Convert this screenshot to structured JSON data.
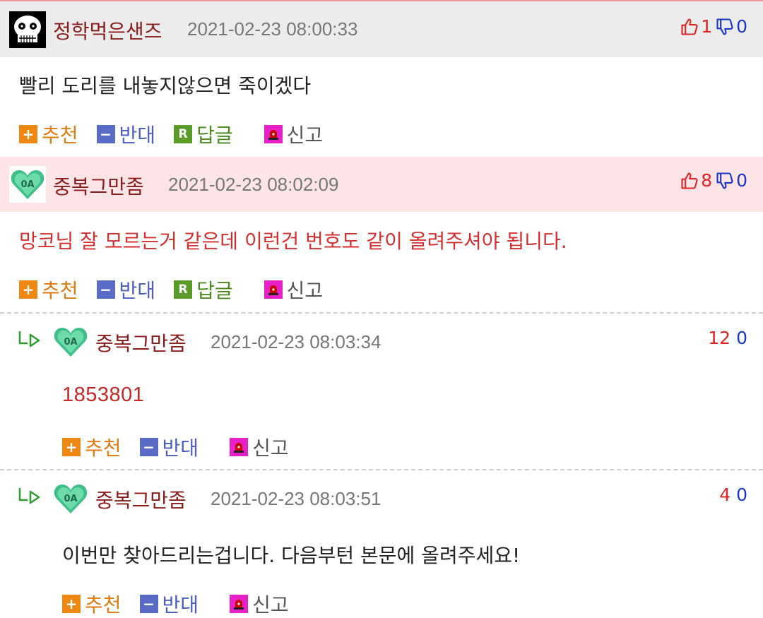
{
  "comments": [
    {
      "nick": "정학먹은샌즈",
      "date": "2021-02-23 08:00:33",
      "up": "1",
      "down": "0",
      "text": "빨리 도리를 내놓지않으면 죽이겠다",
      "avatar_icon": "skull-avatar-icon"
    },
    {
      "nick": "중복그만좀",
      "date": "2021-02-23 08:02:09",
      "up": "8",
      "down": "0",
      "text": "망코님 잘 모르는거 같은데 이런건 번호도 같이 올려주셔야 됩니다.",
      "avatar_icon": "heart-avatar-icon"
    },
    {
      "nick": "중복그만좀",
      "date": "2021-02-23 08:03:34",
      "up": "12",
      "down": "0",
      "text": "1853801",
      "avatar_icon": "heart-avatar-icon"
    },
    {
      "nick": "중복그만좀",
      "date": "2021-02-23 08:03:51",
      "up": "4",
      "down": "0",
      "text": "이번만 찾아드리는겁니다. 다음부턴 본문에 올려주세요!",
      "avatar_icon": "heart-avatar-icon"
    }
  ],
  "actions": {
    "recommend": "추천",
    "oppose": "반대",
    "reply": "답글",
    "report": "신고"
  },
  "colors": {
    "up": "#e02424",
    "down": "#1a36c8",
    "nick": "#8b1a1a",
    "highlight_bg": "#fde4e6",
    "head_bg": "#ececec"
  }
}
